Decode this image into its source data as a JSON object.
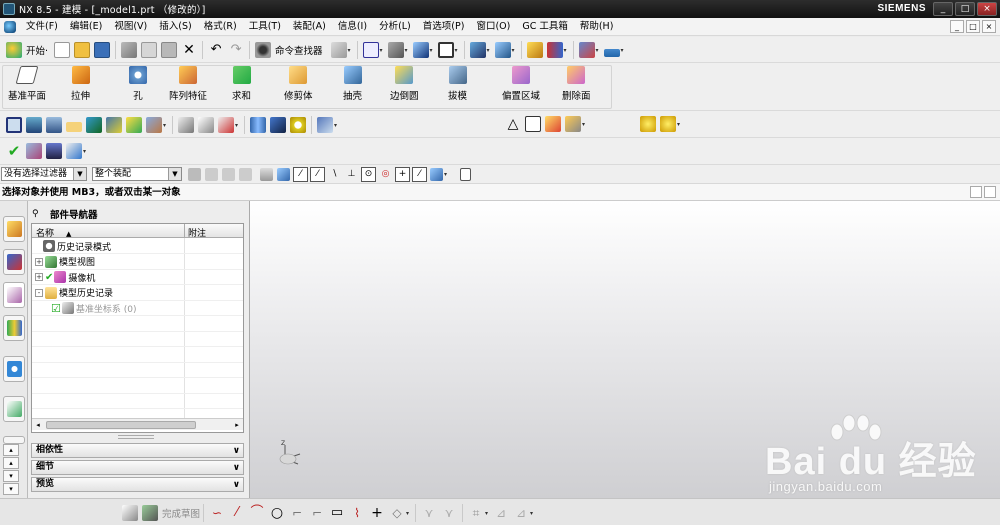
{
  "window": {
    "title": "NX 8.5 - 建模 - [_model1.prt （修改的）]",
    "brand": "SIEMENS",
    "controls": [
      "_",
      "□",
      "×"
    ]
  },
  "menubar": {
    "items": [
      "文件(F)",
      "编辑(E)",
      "视图(V)",
      "插入(S)",
      "格式(R)",
      "工具(T)",
      "装配(A)",
      "信息(I)",
      "分析(L)",
      "首选项(P)",
      "窗口(O)",
      "GC 工具箱",
      "帮助(H)"
    ],
    "doc_controls": [
      "_",
      "□",
      "×"
    ]
  },
  "standard_toolbar": {
    "start_label": "开始·",
    "command_finder_label": "命令查找器"
  },
  "feature_toolbar": {
    "buttons": [
      "基准平面",
      "拉伸",
      "孔",
      "阵列特征",
      "求和",
      "修剪体",
      "抽壳",
      "边倒圆",
      "拔模",
      "偏置区域",
      "删除面"
    ]
  },
  "selection_bar": {
    "filter_value": "没有选择过滤器",
    "scope_value": "整个装配"
  },
  "status": {
    "prompt": "选择对象并使用 MB3，或者双击某一对象"
  },
  "part_navigator": {
    "title": "部件导航器",
    "columns": {
      "name": "名称",
      "note": "附注"
    },
    "rows": [
      {
        "label": "历史记录模式",
        "expander": "",
        "icon": "clock-icon",
        "indent": 1,
        "dim": false
      },
      {
        "label": "模型视图",
        "expander": "+",
        "icon": "model-views-icon",
        "indent": 0,
        "dim": false
      },
      {
        "label": "摄像机",
        "expander": "+",
        "icon": "camera-icon",
        "indent": 0,
        "dim": false
      },
      {
        "label": "模型历史记录",
        "expander": "-",
        "icon": "folder-icon",
        "indent": 0,
        "dim": false
      },
      {
        "label": "基准坐标系 (0)",
        "expander": "",
        "icon": "datum-csys-icon",
        "indent": 2,
        "dim": true
      }
    ],
    "sections": [
      "相依性",
      "细节",
      "预览"
    ]
  },
  "sketch_toolbar": {
    "finish_label": "完成草图"
  },
  "watermark": {
    "line1": "Bai du 经验",
    "line2": "jingyan.baidu.com"
  }
}
